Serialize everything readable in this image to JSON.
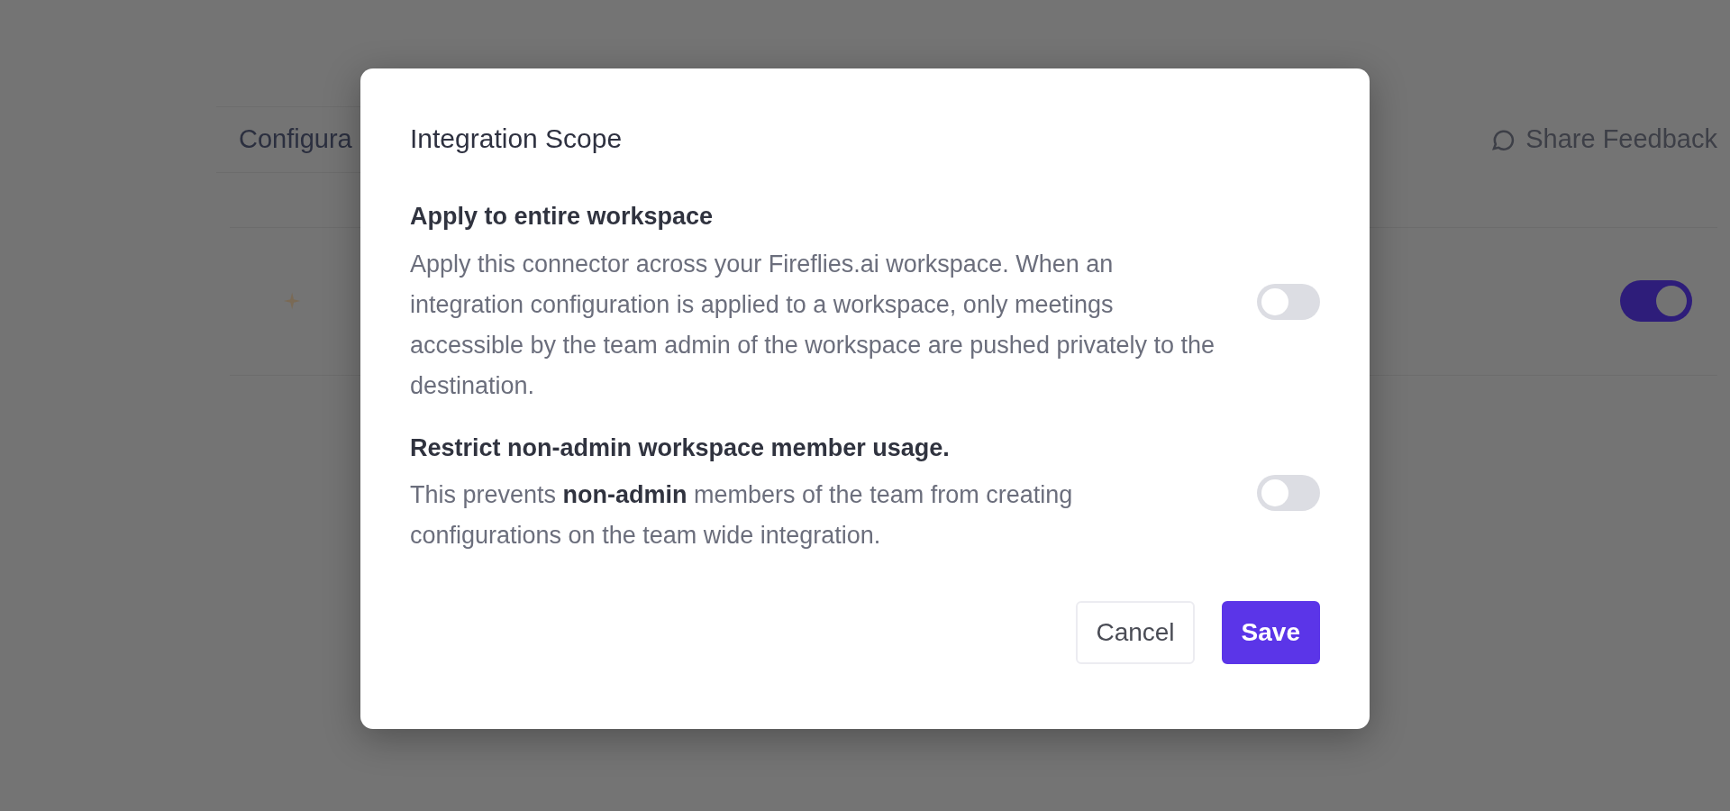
{
  "background": {
    "tab": "Configura",
    "feedback": "Share Feedback",
    "toggle": {
      "on": true
    }
  },
  "modal": {
    "title": "Integration Scope",
    "options": [
      {
        "title": "Apply to entire workspace",
        "description": "Apply this connector across your Fireflies.ai workspace. When an integration configuration is applied to a workspace, only meetings accessible by the team admin of the workspace are pushed privately to the destination.",
        "on": false
      },
      {
        "title": "Restrict **non-admin** workspace member usage.",
        "description": "This prevents **non-admin** members of the team from creating configurations on the team wide integration.",
        "on": false
      }
    ],
    "buttons": [
      {
        "label": "Cancel",
        "kind": "secondary"
      },
      {
        "label": "Save",
        "kind": "primary"
      }
    ]
  }
}
